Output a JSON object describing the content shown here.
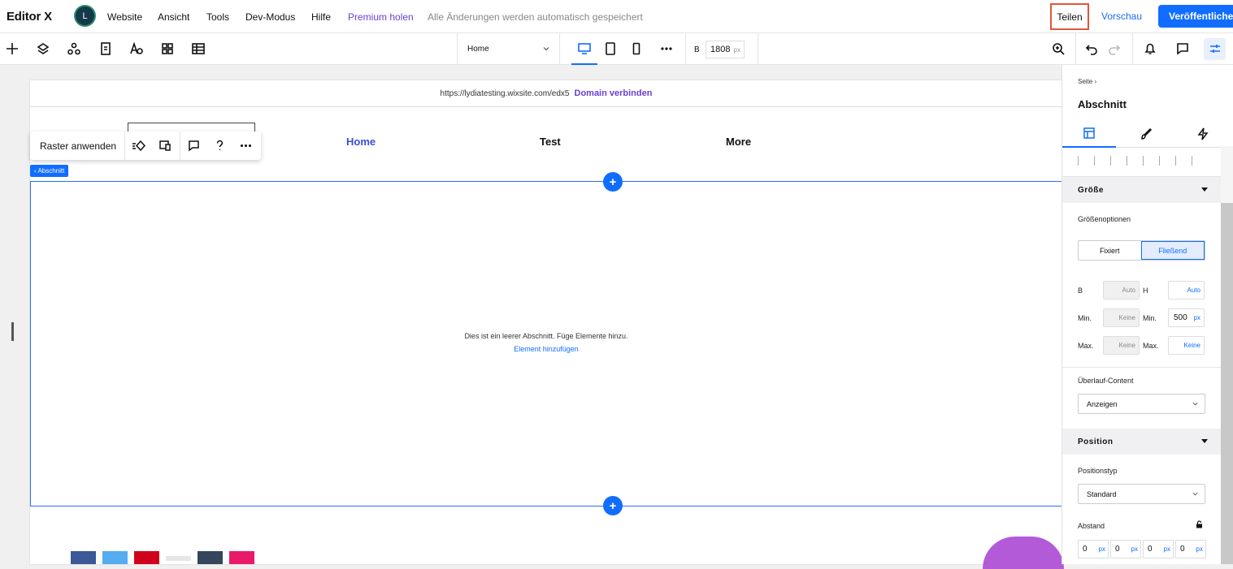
{
  "topbar": {
    "logo": "Editor X",
    "avatar_letter": "L",
    "menu": [
      "Website",
      "Ansicht",
      "Tools",
      "Dev-Modus",
      "Hilfe"
    ],
    "premium": "Premium holen",
    "autosave": "Alle Änderungen werden automatisch gespeichert",
    "share": "Teilen",
    "preview": "Vorschau",
    "publish": "Veröffentlichen"
  },
  "toolbar": {
    "page": "Home",
    "width_label": "B",
    "width_value": "1808",
    "width_unit": "px"
  },
  "canvas": {
    "url": "https://lydiatesting.wixsite.com/edx5",
    "connect_domain": "Domain verbinden",
    "nav": [
      "Home",
      "Test",
      "More"
    ],
    "section_tag": "‹ Abschnitt",
    "empty_text": "Dies ist ein leerer Abschnitt. Füge Elemente hinzu.",
    "add_element": "Element hinzufügen",
    "apply_grid": "Raster anwenden"
  },
  "panel": {
    "breadcrumb": "Seite  ›",
    "title": "Abschnitt",
    "size_head": "Größe",
    "size_options": "Größenoptionen",
    "fixed": "Fixiert",
    "fluid": "Fließend",
    "w_label": "B",
    "h_label": "H",
    "w_value": "Auto",
    "h_value": "Auto",
    "min_label": "Min.",
    "min_w": "Keine",
    "min_h": "500",
    "min_h_unit": "px",
    "max_label": "Max.",
    "max_w": "Keine",
    "max_h": "Keine",
    "overflow_label": "Überlauf-Content",
    "overflow_value": "Anzeigen",
    "position_head": "Position",
    "position_type_label": "Positionstyp",
    "position_type_value": "Standard",
    "spacing_label": "Abstand",
    "spacing": [
      "0",
      "0",
      "0",
      "0"
    ],
    "spacing_unit": "px"
  },
  "colors": {
    "accent": "#116dff",
    "premium": "#6b3fd4",
    "share_border": "#e0573a"
  }
}
